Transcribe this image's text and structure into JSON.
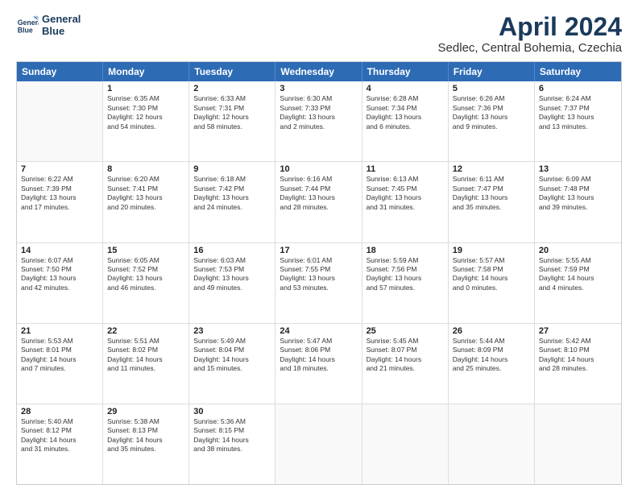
{
  "header": {
    "logo_line1": "General",
    "logo_line2": "Blue",
    "main_title": "April 2024",
    "subtitle": "Sedlec, Central Bohemia, Czechia"
  },
  "days_of_week": [
    "Sunday",
    "Monday",
    "Tuesday",
    "Wednesday",
    "Thursday",
    "Friday",
    "Saturday"
  ],
  "weeks": [
    [
      {
        "day": "",
        "text": ""
      },
      {
        "day": "1",
        "text": "Sunrise: 6:35 AM\nSunset: 7:30 PM\nDaylight: 12 hours\nand 54 minutes."
      },
      {
        "day": "2",
        "text": "Sunrise: 6:33 AM\nSunset: 7:31 PM\nDaylight: 12 hours\nand 58 minutes."
      },
      {
        "day": "3",
        "text": "Sunrise: 6:30 AM\nSunset: 7:33 PM\nDaylight: 13 hours\nand 2 minutes."
      },
      {
        "day": "4",
        "text": "Sunrise: 6:28 AM\nSunset: 7:34 PM\nDaylight: 13 hours\nand 6 minutes."
      },
      {
        "day": "5",
        "text": "Sunrise: 6:26 AM\nSunset: 7:36 PM\nDaylight: 13 hours\nand 9 minutes."
      },
      {
        "day": "6",
        "text": "Sunrise: 6:24 AM\nSunset: 7:37 PM\nDaylight: 13 hours\nand 13 minutes."
      }
    ],
    [
      {
        "day": "7",
        "text": "Sunrise: 6:22 AM\nSunset: 7:39 PM\nDaylight: 13 hours\nand 17 minutes."
      },
      {
        "day": "8",
        "text": "Sunrise: 6:20 AM\nSunset: 7:41 PM\nDaylight: 13 hours\nand 20 minutes."
      },
      {
        "day": "9",
        "text": "Sunrise: 6:18 AM\nSunset: 7:42 PM\nDaylight: 13 hours\nand 24 minutes."
      },
      {
        "day": "10",
        "text": "Sunrise: 6:16 AM\nSunset: 7:44 PM\nDaylight: 13 hours\nand 28 minutes."
      },
      {
        "day": "11",
        "text": "Sunrise: 6:13 AM\nSunset: 7:45 PM\nDaylight: 13 hours\nand 31 minutes."
      },
      {
        "day": "12",
        "text": "Sunrise: 6:11 AM\nSunset: 7:47 PM\nDaylight: 13 hours\nand 35 minutes."
      },
      {
        "day": "13",
        "text": "Sunrise: 6:09 AM\nSunset: 7:48 PM\nDaylight: 13 hours\nand 39 minutes."
      }
    ],
    [
      {
        "day": "14",
        "text": "Sunrise: 6:07 AM\nSunset: 7:50 PM\nDaylight: 13 hours\nand 42 minutes."
      },
      {
        "day": "15",
        "text": "Sunrise: 6:05 AM\nSunset: 7:52 PM\nDaylight: 13 hours\nand 46 minutes."
      },
      {
        "day": "16",
        "text": "Sunrise: 6:03 AM\nSunset: 7:53 PM\nDaylight: 13 hours\nand 49 minutes."
      },
      {
        "day": "17",
        "text": "Sunrise: 6:01 AM\nSunset: 7:55 PM\nDaylight: 13 hours\nand 53 minutes."
      },
      {
        "day": "18",
        "text": "Sunrise: 5:59 AM\nSunset: 7:56 PM\nDaylight: 13 hours\nand 57 minutes."
      },
      {
        "day": "19",
        "text": "Sunrise: 5:57 AM\nSunset: 7:58 PM\nDaylight: 14 hours\nand 0 minutes."
      },
      {
        "day": "20",
        "text": "Sunrise: 5:55 AM\nSunset: 7:59 PM\nDaylight: 14 hours\nand 4 minutes."
      }
    ],
    [
      {
        "day": "21",
        "text": "Sunrise: 5:53 AM\nSunset: 8:01 PM\nDaylight: 14 hours\nand 7 minutes."
      },
      {
        "day": "22",
        "text": "Sunrise: 5:51 AM\nSunset: 8:02 PM\nDaylight: 14 hours\nand 11 minutes."
      },
      {
        "day": "23",
        "text": "Sunrise: 5:49 AM\nSunset: 8:04 PM\nDaylight: 14 hours\nand 15 minutes."
      },
      {
        "day": "24",
        "text": "Sunrise: 5:47 AM\nSunset: 8:06 PM\nDaylight: 14 hours\nand 18 minutes."
      },
      {
        "day": "25",
        "text": "Sunrise: 5:45 AM\nSunset: 8:07 PM\nDaylight: 14 hours\nand 21 minutes."
      },
      {
        "day": "26",
        "text": "Sunrise: 5:44 AM\nSunset: 8:09 PM\nDaylight: 14 hours\nand 25 minutes."
      },
      {
        "day": "27",
        "text": "Sunrise: 5:42 AM\nSunset: 8:10 PM\nDaylight: 14 hours\nand 28 minutes."
      }
    ],
    [
      {
        "day": "28",
        "text": "Sunrise: 5:40 AM\nSunset: 8:12 PM\nDaylight: 14 hours\nand 31 minutes."
      },
      {
        "day": "29",
        "text": "Sunrise: 5:38 AM\nSunset: 8:13 PM\nDaylight: 14 hours\nand 35 minutes."
      },
      {
        "day": "30",
        "text": "Sunrise: 5:36 AM\nSunset: 8:15 PM\nDaylight: 14 hours\nand 38 minutes."
      },
      {
        "day": "",
        "text": ""
      },
      {
        "day": "",
        "text": ""
      },
      {
        "day": "",
        "text": ""
      },
      {
        "day": "",
        "text": ""
      }
    ]
  ]
}
